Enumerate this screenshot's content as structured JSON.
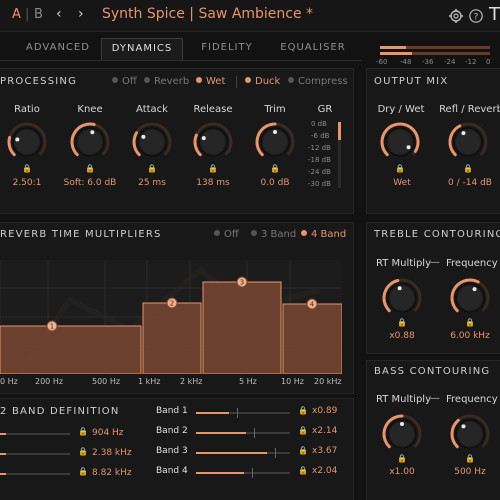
{
  "topbar": {
    "ab_a": "A",
    "ab_sep": "|",
    "ab_b": "B",
    "prev_label": "‹",
    "next_label": "›",
    "preset": "Synth Spice | Saw Ambience *",
    "settings_icon": "gear-icon",
    "help_icon": "help-icon",
    "logo": "T"
  },
  "tabs": [
    "ADVANCED",
    "DYNAMICS",
    "FIDELITY",
    "EQUALISER"
  ],
  "active_tab": "DYNAMICS",
  "output_meter": {
    "ticks": [
      "-60",
      "-48",
      "-36",
      "-24",
      "-12",
      "0"
    ]
  },
  "processing": {
    "title": "PROCESSING",
    "modes": [
      {
        "label": "Off",
        "on": false
      },
      {
        "label": "Reverb",
        "on": false
      },
      {
        "label": "Wet",
        "on": true
      }
    ],
    "detect": [
      {
        "label": "Duck",
        "on": true
      },
      {
        "label": "Compress",
        "on": false
      }
    ],
    "knobs": [
      {
        "label": "Ratio",
        "value": "2.50:1"
      },
      {
        "label": "Knee",
        "value": "Soft: 6.0 dB"
      },
      {
        "label": "Attack",
        "value": "25 ms"
      },
      {
        "label": "Release",
        "value": "138 ms"
      },
      {
        "label": "Trim",
        "value": "0.0 dB"
      }
    ],
    "gr": {
      "label": "GR",
      "ticks": [
        "0 dB",
        "-6 dB",
        "-12 dB",
        "-18 dB",
        "-24 dB",
        "-30 dB"
      ]
    }
  },
  "output_mix": {
    "title": "OUTPUT MIX",
    "knobs": [
      {
        "label": "Dry / Wet",
        "value": "Wet"
      },
      {
        "label": "Refl / Reverb",
        "value": "0 / -14 dB"
      }
    ]
  },
  "reverb_time": {
    "title": "REVERB TIME MULTIPLIERS",
    "modes": [
      {
        "label": "Off",
        "on": false
      },
      {
        "label": "3 Band",
        "on": false
      },
      {
        "label": "4 Band",
        "on": true
      }
    ],
    "axis": [
      "0 Hz",
      "200 Hz",
      "500 Hz",
      "1 kHz",
      "2 kHz",
      "5 Hz",
      "10 Hz",
      "20 kHz"
    ],
    "bands": [
      "1",
      "2",
      "3",
      "4"
    ]
  },
  "treble": {
    "title": "TREBLE CONTOURING",
    "label_a": "RT Multiply",
    "dash": "—",
    "label_b": "Frequency",
    "value_a": "x0.88",
    "value_b": "6.00 kHz"
  },
  "bass": {
    "title": "BASS CONTOURING",
    "label_a": "RT Multiply",
    "dash": "—",
    "label_b": "Frequency",
    "value_a": "x1.00",
    "value_b": "500 Hz"
  },
  "band_definition": {
    "title": "2 BAND DEFINITION",
    "crossovers": [
      "904 Hz",
      "2.38 kHz",
      "8.82 kHz"
    ],
    "bands": [
      {
        "label": "Band 1",
        "value": "x0.89",
        "level": 0.35
      },
      {
        "label": "Band 2",
        "value": "x2.14",
        "level": 0.53
      },
      {
        "label": "Band 3",
        "value": "x3.67",
        "level": 0.75
      },
      {
        "label": "Band 4",
        "value": "x2.04",
        "level": 0.51
      }
    ]
  },
  "colors": {
    "accent": "#e8956a",
    "background": "#121212",
    "panel": "#181818",
    "bar_fill": "#7a4632"
  }
}
